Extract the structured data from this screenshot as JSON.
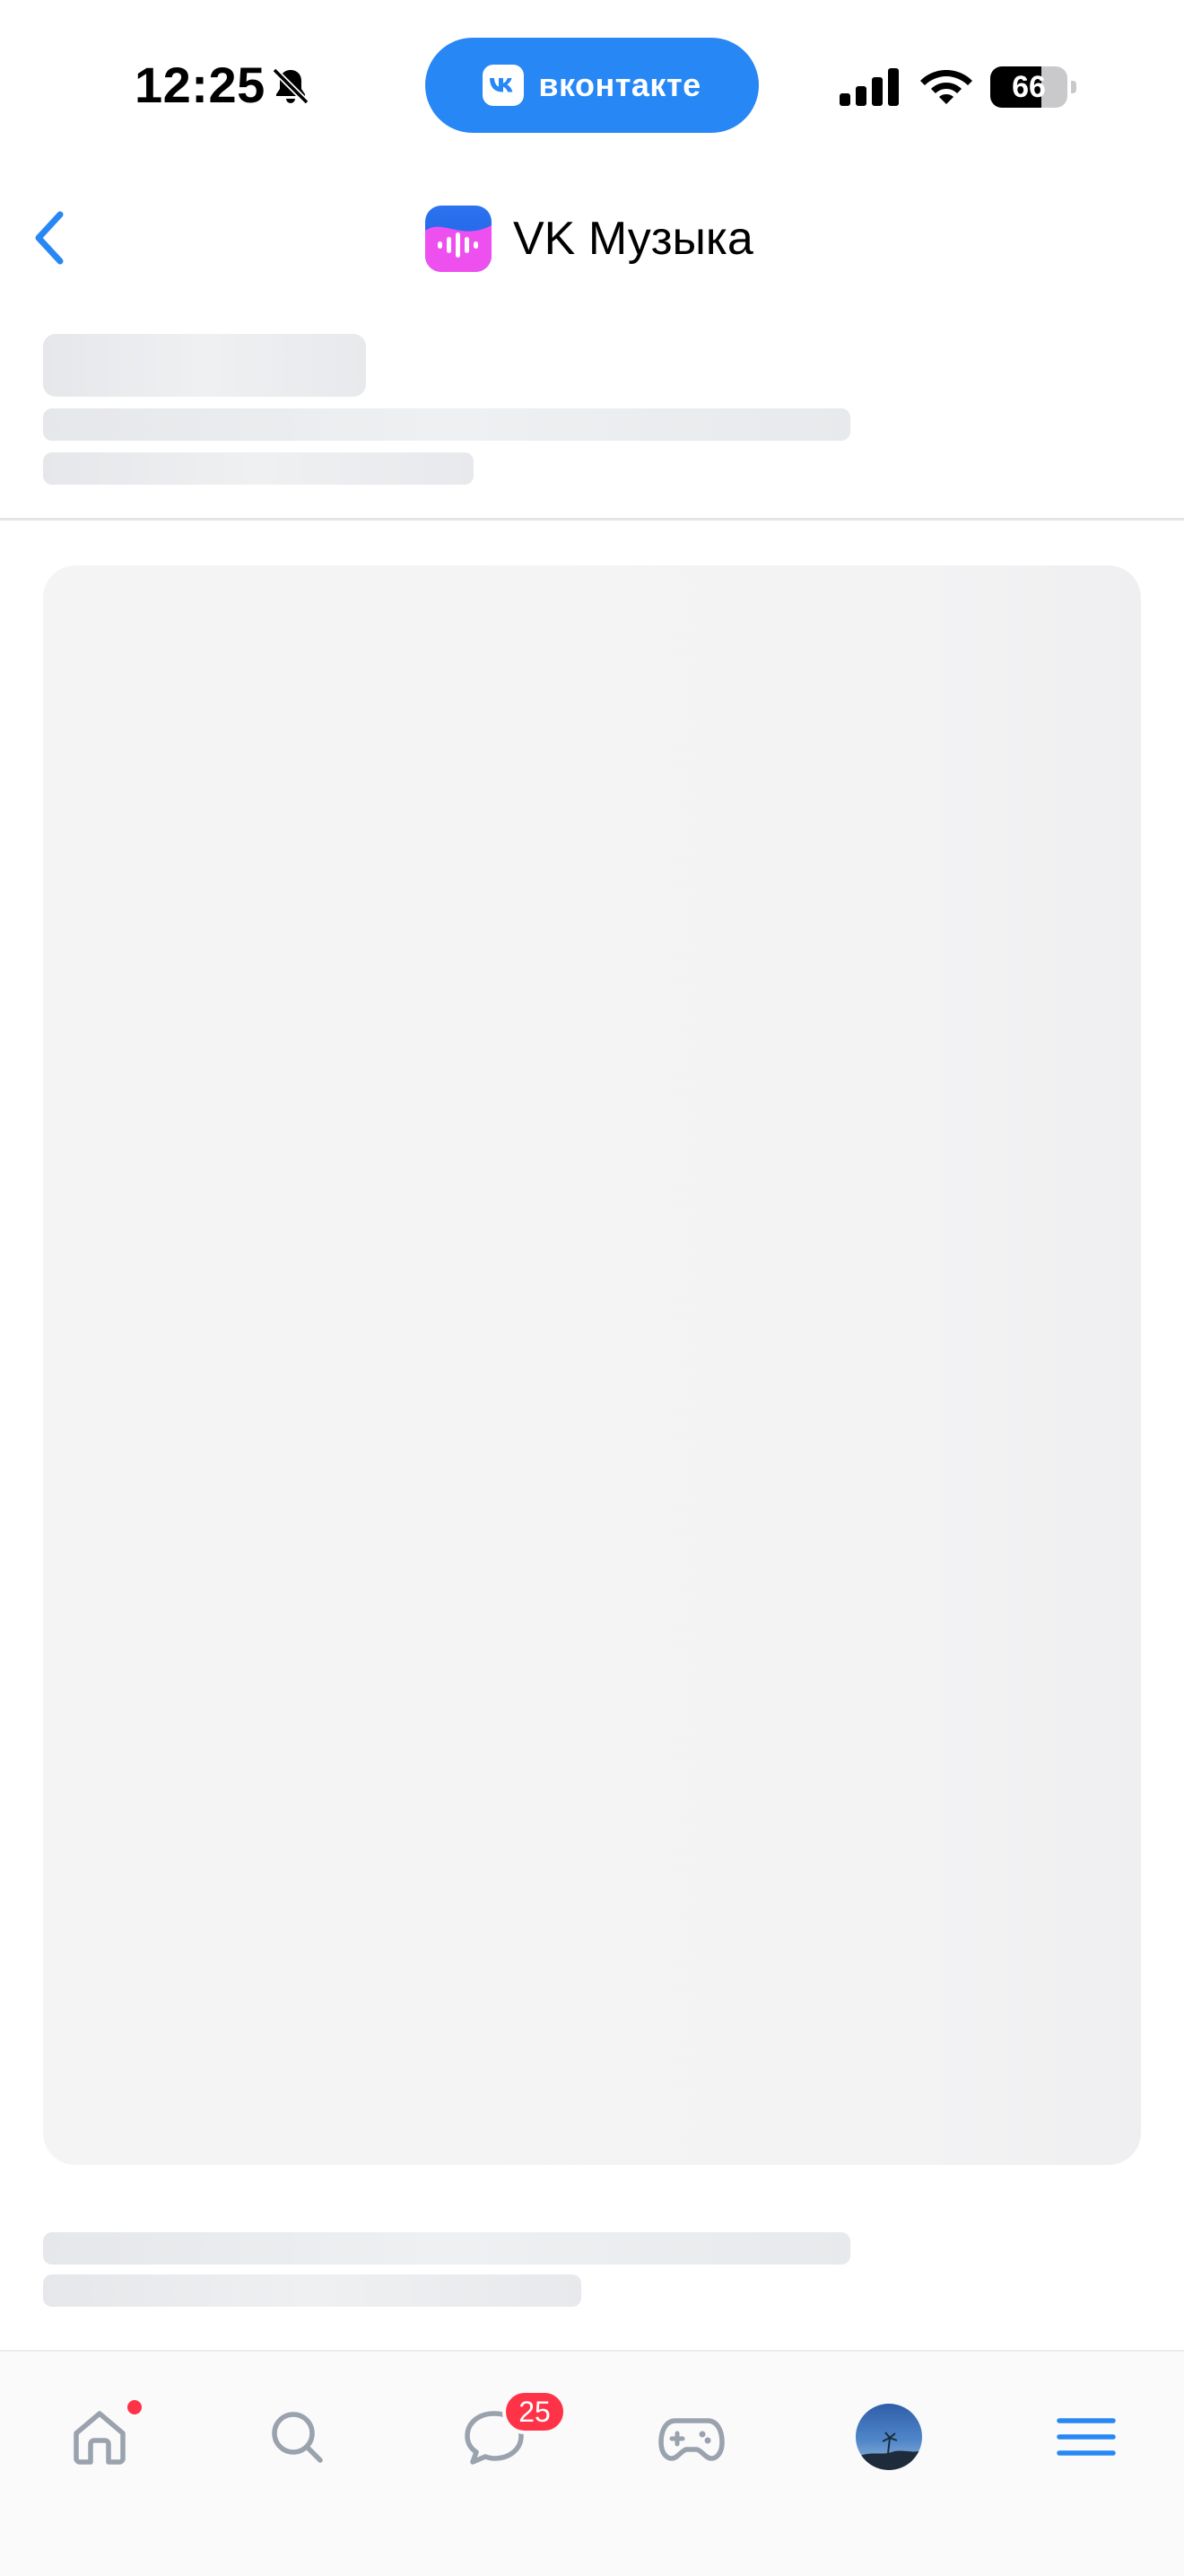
{
  "status_bar": {
    "time": "12:25",
    "bell_icon": "bell-muted-icon",
    "battery_level": "66",
    "battery_fraction": 0.66,
    "signal_icon": "cellular-signal-icon",
    "wifi_icon": "wifi-icon"
  },
  "vk_pill": {
    "label": "вконтакте",
    "logo_icon": "vk-logo-icon",
    "color": "#2787f5"
  },
  "header": {
    "back_icon": "chevron-left-icon",
    "title": "VK Музыка",
    "app_icon": "vk-music-logo-icon"
  },
  "tab_bar": {
    "items": [
      {
        "id": "home",
        "icon": "home-icon",
        "has_dot": true
      },
      {
        "id": "search",
        "icon": "search-icon"
      },
      {
        "id": "messages",
        "icon": "chat-bubble-icon",
        "badge": "25"
      },
      {
        "id": "games",
        "icon": "gamepad-icon"
      },
      {
        "id": "profile",
        "icon": "avatar"
      },
      {
        "id": "menu",
        "icon": "menu-icon"
      }
    ]
  },
  "colors": {
    "accent": "#2787f5",
    "badge": "#ff3347",
    "icon_gray": "#99a2ad",
    "skeleton": "#e6e7ea"
  }
}
